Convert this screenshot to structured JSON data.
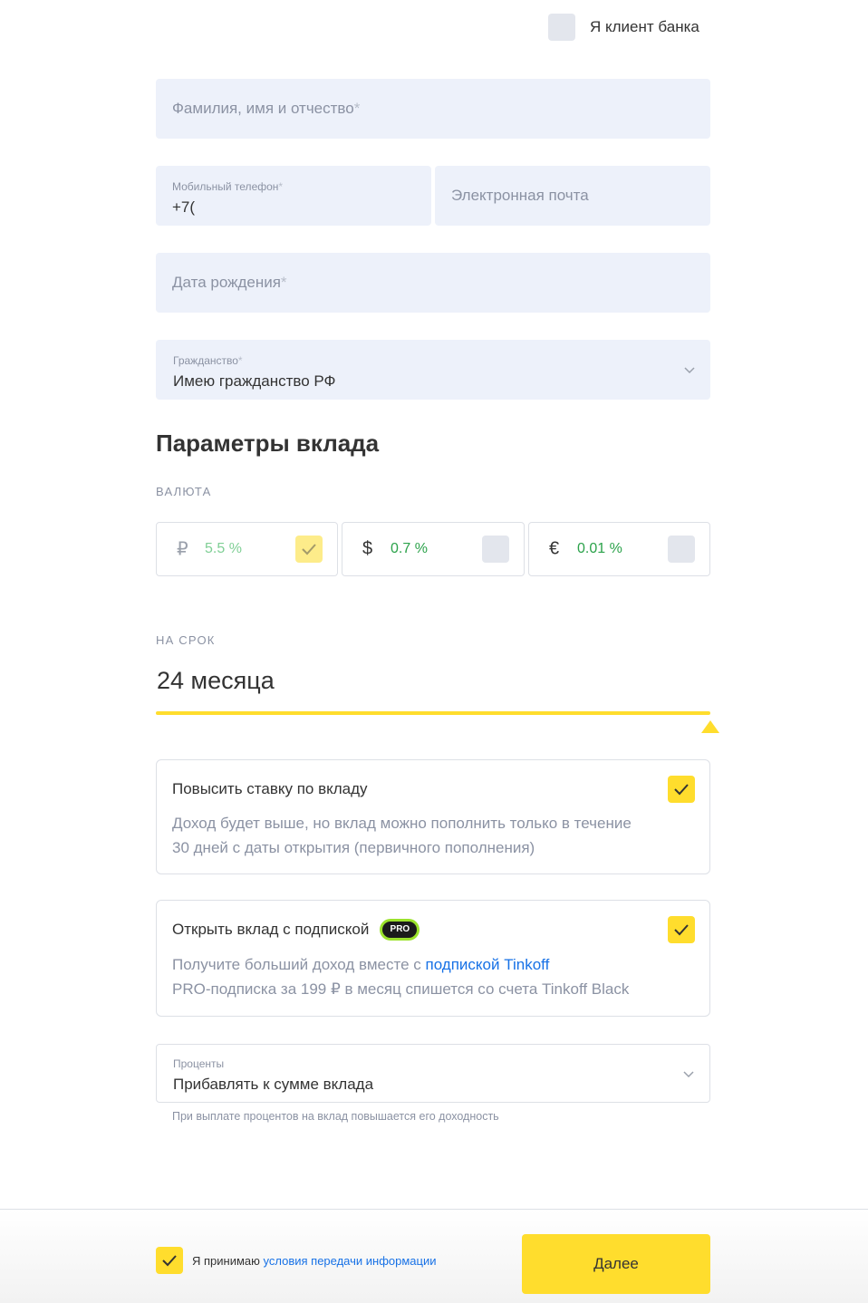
{
  "header": {
    "client_checkbox_label": "Я клиент банка"
  },
  "form": {
    "full_name": {
      "placeholder": "Фамилия, имя и отчество",
      "required_mark": "*"
    },
    "phone": {
      "label": "Мобильный телефон",
      "required_mark": "*",
      "value": "+7("
    },
    "email": {
      "placeholder": "Электронная почта"
    },
    "birth_date": {
      "placeholder": "Дата рождения",
      "required_mark": "*"
    },
    "citizenship": {
      "label": "Гражданство",
      "required_mark": "*",
      "value": "Имею гражданство РФ"
    }
  },
  "deposit": {
    "title": "Параметры вклада",
    "currency_label": "ВАЛЮТА",
    "currencies": [
      {
        "symbol": "₽",
        "rate": "5.5 %",
        "selected": true,
        "disabled": true
      },
      {
        "symbol": "$",
        "rate": "0.7 %",
        "selected": false,
        "disabled": false
      },
      {
        "symbol": "€",
        "rate": "0.01 %",
        "selected": false,
        "disabled": false
      }
    ],
    "term_label": "НА СРОК",
    "term_value": "24 месяца",
    "term_slider_position": 1.0
  },
  "options": {
    "raise_rate": {
      "title": "Повысить ставку по вкладу",
      "desc_line1": "Доход будет выше, но вклад можно пополнить только в течение",
      "desc_line2": "30 дней с даты открытия (первичного пополнения)",
      "checked": true
    },
    "subscription": {
      "title": "Открыть вклад с подпиской",
      "badge": "PRO",
      "desc_prefix": "Получите больший доход вместе с ",
      "desc_link": "подпиской Tinkoff",
      "desc_line2": "PRO-подписка за 199 ₽ в месяц спишется со счета Tinkoff Black",
      "checked": true
    }
  },
  "interest": {
    "label": "Проценты",
    "value": "Прибавлять к сумме вклада",
    "hint": "При выплате процентов на вклад повышается его доходность"
  },
  "footer": {
    "consent_prefix": "Я принимаю ",
    "consent_link": "условия передачи информации",
    "consent_checked": true,
    "next_label": "Далее"
  },
  "colors": {
    "accent_yellow": "#ffdd2d",
    "field_bg": "#edf1fa",
    "rate_green": "#2ba24a",
    "link_blue": "#1771e6",
    "pro_green": "#9be22c"
  }
}
